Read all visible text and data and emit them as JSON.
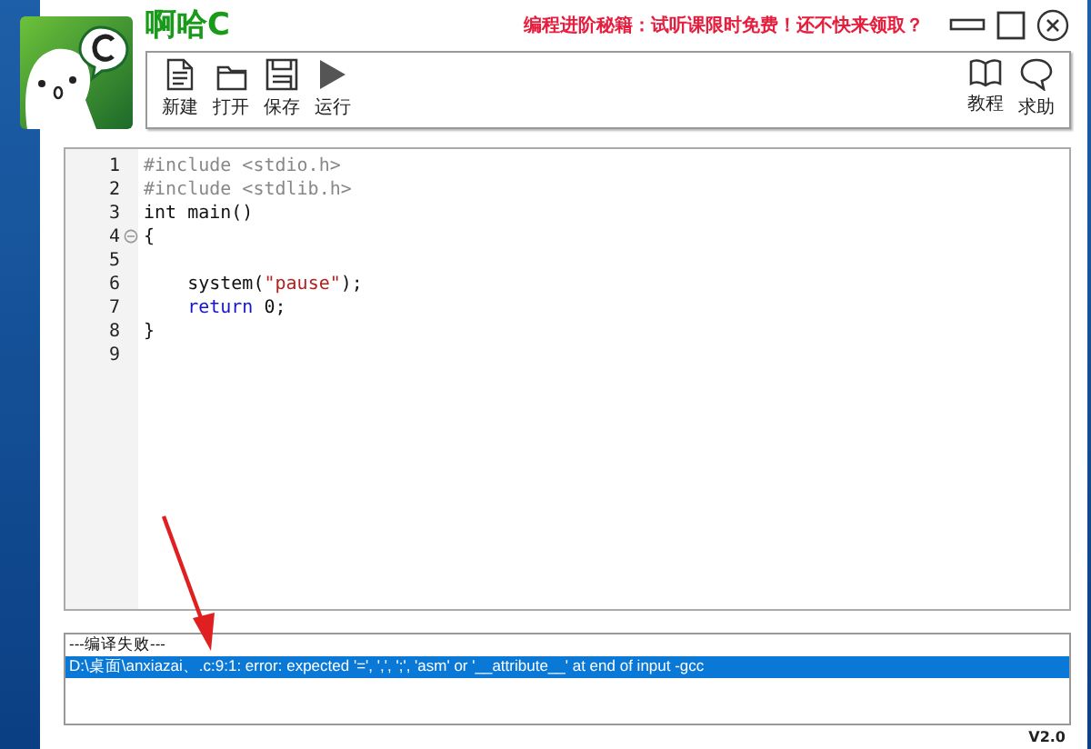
{
  "window": {
    "title": "啊哈C",
    "promo": "编程进阶秘籍：试听课限时免费！还不快来领取？",
    "version": "V2.0"
  },
  "toolbar": {
    "left": [
      {
        "label": "新建"
      },
      {
        "label": "打开"
      },
      {
        "label": "保存"
      },
      {
        "label": "运行"
      }
    ],
    "right": [
      {
        "label": "教程"
      },
      {
        "label": "求助"
      }
    ]
  },
  "editor": {
    "lines": [
      {
        "number": "1",
        "fold": false,
        "tokens": [
          {
            "text": "#include <stdio.h>",
            "kind": "preprocessor"
          }
        ]
      },
      {
        "number": "2",
        "fold": false,
        "tokens": [
          {
            "text": "#include <stdlib.h>",
            "kind": "preprocessor"
          }
        ]
      },
      {
        "number": "3",
        "fold": false,
        "tokens": [
          {
            "text": "int main()",
            "kind": "plain"
          }
        ]
      },
      {
        "number": "4",
        "fold": true,
        "tokens": [
          {
            "text": "{",
            "kind": "plain"
          }
        ]
      },
      {
        "number": "5",
        "fold": false
      },
      {
        "number": "6",
        "fold": false,
        "tokens": [
          {
            "text": "    system(",
            "kind": "plain"
          },
          {
            "text": "\"pause\"",
            "kind": "string"
          },
          {
            "text": ");",
            "kind": "plain"
          }
        ]
      },
      {
        "number": "7",
        "fold": false,
        "tokens": [
          {
            "text": "    return",
            "kind": "keyword"
          },
          {
            "text": " 0;",
            "kind": "plain"
          }
        ]
      },
      {
        "number": "8",
        "fold": false,
        "tokens": [
          {
            "text": "}",
            "kind": "plain"
          }
        ]
      },
      {
        "number": "9",
        "fold": false
      }
    ]
  },
  "output": {
    "heading": "---编译失败---",
    "lines": [
      {
        "text": "D:\\桌面\\anxiazai、.c:9:1: error: expected '=', ',', ';', 'asm' or '__attribute__' at end of input -gcc",
        "selected": true
      }
    ]
  }
}
